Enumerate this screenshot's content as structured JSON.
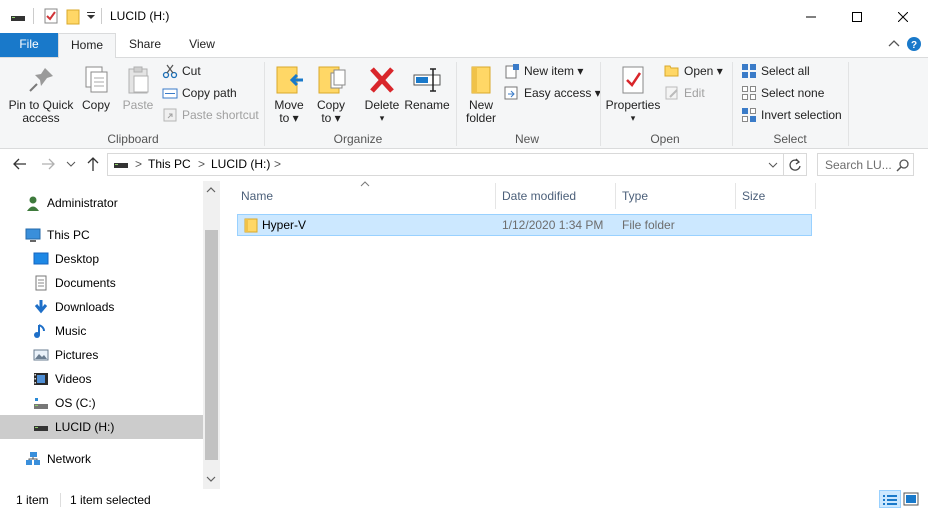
{
  "window": {
    "title": "LUCID (H:)",
    "minimize_glyph": "—",
    "maximize_glyph": "☐",
    "close_glyph": "✕"
  },
  "ribbon_tabs": [
    "File",
    "Home",
    "Share",
    "View"
  ],
  "ribbon": {
    "clipboard": {
      "label": "Clipboard",
      "pin": "Pin to Quick access",
      "pin_line1": "Pin to Quick",
      "pin_line2": "access",
      "copy": "Copy",
      "paste": "Paste",
      "cut": "Cut",
      "copy_path": "Copy path",
      "paste_shortcut": "Paste shortcut"
    },
    "organize": {
      "label": "Organize",
      "move_to_line1": "Move",
      "move_to_line2": "to ▾",
      "copy_to_line1": "Copy",
      "copy_to_line2": "to ▾",
      "delete": "Delete",
      "delete_arrow": "▾",
      "rename": "Rename"
    },
    "new": {
      "label": "New",
      "new_folder_line1": "New",
      "new_folder_line2": "folder",
      "new_item": "New item ▾",
      "easy_access": "Easy access ▾"
    },
    "open": {
      "label": "Open",
      "properties": "Properties",
      "properties_arrow": "▾",
      "open": "Open ▾",
      "edit": "Edit"
    },
    "select": {
      "label": "Select",
      "select_all": "Select all",
      "select_none": "Select none",
      "invert_selection": "Invert selection"
    }
  },
  "address": {
    "crumbs": [
      "This PC",
      "LUCID (H:)"
    ],
    "separator": ">",
    "search_placeholder": "Search LU..."
  },
  "nav_pane": {
    "items": [
      {
        "label": "Administrator",
        "icon": "user-icon"
      },
      {
        "label": "This PC",
        "icon": "computer-icon"
      },
      {
        "label": "Desktop",
        "icon": "desktop-icon"
      },
      {
        "label": "Documents",
        "icon": "documents-icon"
      },
      {
        "label": "Downloads",
        "icon": "downloads-icon"
      },
      {
        "label": "Music",
        "icon": "music-icon"
      },
      {
        "label": "Pictures",
        "icon": "pictures-icon"
      },
      {
        "label": "Videos",
        "icon": "videos-icon"
      },
      {
        "label": "OS (C:)",
        "icon": "drive-icon"
      },
      {
        "label": "LUCID (H:)",
        "icon": "usb-drive-icon"
      },
      {
        "label": "Network",
        "icon": "network-icon"
      }
    ],
    "selected": "LUCID (H:)"
  },
  "file_list": {
    "columns": [
      "Name",
      "Date modified",
      "Type",
      "Size"
    ],
    "rows": [
      {
        "name": "Hyper-V",
        "date_modified": "1/12/2020 1:34 PM",
        "type": "File folder",
        "size": ""
      }
    ]
  },
  "status": {
    "item_count": "1 item",
    "selected_count": "1 item selected"
  },
  "colors": {
    "accent": "#1979ca",
    "selection_bg": "#cce8ff",
    "selection_border": "#99d1ff",
    "nav_selected_bg": "#cccccc",
    "folder_yellow": "#ffd766"
  }
}
